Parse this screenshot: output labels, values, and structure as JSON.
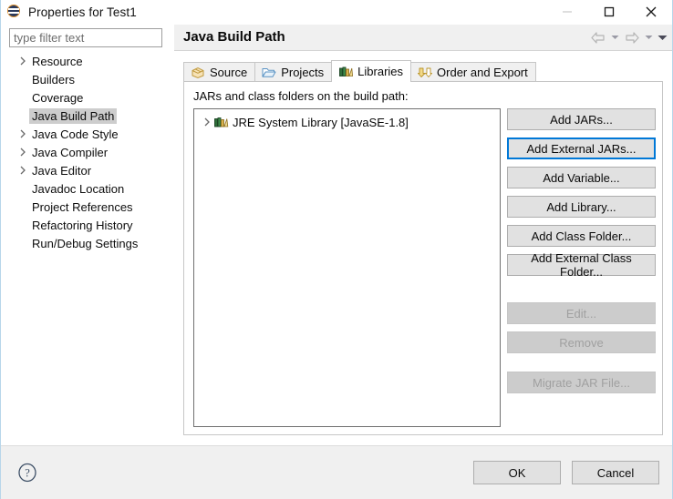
{
  "window": {
    "title": "Properties for Test1",
    "icon": "eclipse-icon",
    "controls": {
      "minimize": "minimize-icon",
      "maximize": "maximize-icon",
      "close": "close-icon"
    }
  },
  "sidebar": {
    "filter": {
      "placeholder": "type filter text",
      "value": ""
    },
    "items": [
      {
        "label": "Resource",
        "expandable": true,
        "selected": false
      },
      {
        "label": "Builders",
        "expandable": false,
        "selected": false
      },
      {
        "label": "Coverage",
        "expandable": false,
        "selected": false
      },
      {
        "label": "Java Build Path",
        "expandable": false,
        "selected": true
      },
      {
        "label": "Java Code Style",
        "expandable": true,
        "selected": false
      },
      {
        "label": "Java Compiler",
        "expandable": true,
        "selected": false
      },
      {
        "label": "Java Editor",
        "expandable": true,
        "selected": false
      },
      {
        "label": "Javadoc Location",
        "expandable": false,
        "selected": false
      },
      {
        "label": "Project References",
        "expandable": false,
        "selected": false
      },
      {
        "label": "Refactoring History",
        "expandable": false,
        "selected": false
      },
      {
        "label": "Run/Debug Settings",
        "expandable": false,
        "selected": false
      }
    ]
  },
  "pane": {
    "title": "Java Build Path",
    "nav": {
      "back": "back-arrow-icon",
      "back_menu": "chevron-down-icon",
      "forward": "forward-arrow-icon",
      "forward_menu": "chevron-down-icon",
      "view_menu": "chevron-down-icon"
    }
  },
  "tabs": [
    {
      "label": "Source",
      "icon": "source-package-icon",
      "active": false
    },
    {
      "label": "Projects",
      "icon": "folder-icon",
      "active": false
    },
    {
      "label": "Libraries",
      "icon": "books-icon",
      "active": true
    },
    {
      "label": "Order and Export",
      "icon": "order-export-icon",
      "active": false
    }
  ],
  "libraries_tab": {
    "group_label": "JARs and class folders on the build path:",
    "entries": [
      {
        "label": "JRE System Library [JavaSE-1.8]",
        "icon": "books-icon",
        "expandable": true
      }
    ],
    "buttons": [
      {
        "label": "Add JARs...",
        "enabled": true,
        "focused": false
      },
      {
        "label": "Add External JARs...",
        "enabled": true,
        "focused": true
      },
      {
        "label": "Add Variable...",
        "enabled": true,
        "focused": false
      },
      {
        "label": "Add Library...",
        "enabled": true,
        "focused": false
      },
      {
        "label": "Add Class Folder...",
        "enabled": true,
        "focused": false
      },
      {
        "label": "Add External Class Folder...",
        "enabled": true,
        "focused": false
      },
      {
        "label": "Edit...",
        "enabled": false,
        "focused": false
      },
      {
        "label": "Remove",
        "enabled": false,
        "focused": false
      },
      {
        "label": "Migrate JAR File...",
        "enabled": false,
        "focused": false
      }
    ]
  },
  "footer": {
    "help": "help-icon",
    "ok_label": "OK",
    "cancel_label": "Cancel"
  },
  "colors": {
    "accent": "#0078d7",
    "button_face": "#e1e1e1",
    "panel": "#f0f0f0",
    "selection": "#cdcdcd",
    "window_border": "#b8d6ea"
  }
}
